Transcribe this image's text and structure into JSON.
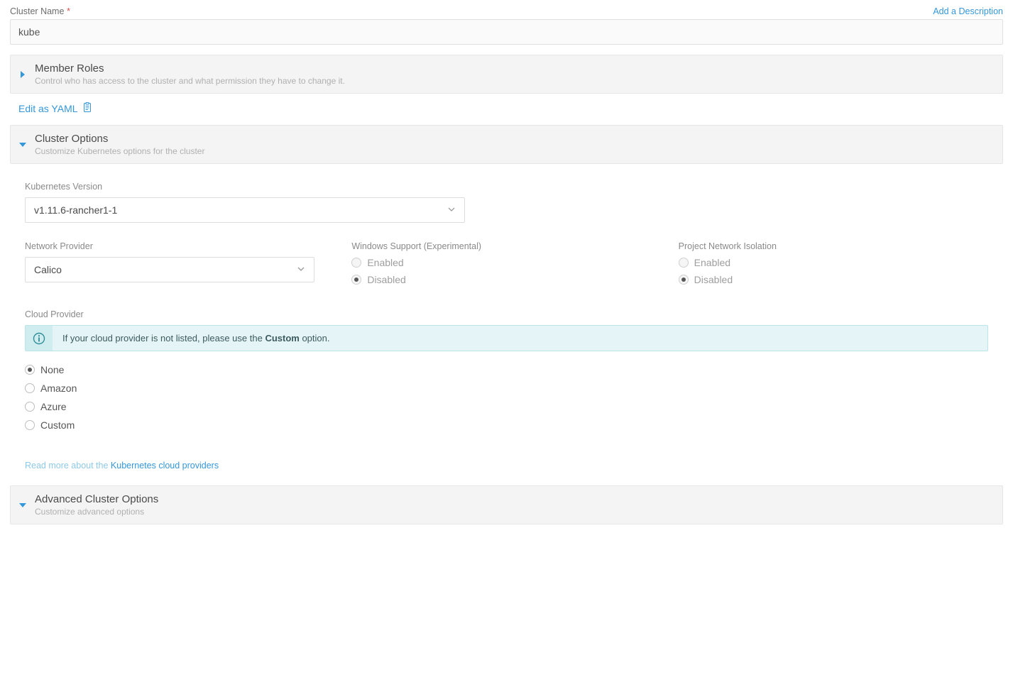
{
  "form": {
    "cluster_name_label": "Cluster Name",
    "add_description": "Add a Description",
    "cluster_name_value": "kube"
  },
  "sections": {
    "member_roles": {
      "title": "Member Roles",
      "desc": "Control who has access to the cluster and what permission they have to change it."
    },
    "edit_yaml": "Edit as YAML",
    "cluster_options": {
      "title": "Cluster Options",
      "desc": "Customize Kubernetes options for the cluster"
    },
    "advanced": {
      "title": "Advanced Cluster Options",
      "desc": "Customize advanced options"
    }
  },
  "options": {
    "k8s_version_label": "Kubernetes Version",
    "k8s_version_value": "v1.11.6-rancher1-1",
    "network_provider_label": "Network Provider",
    "network_provider_value": "Calico",
    "windows_support_label": "Windows Support (Experimental)",
    "windows_enabled": "Enabled",
    "windows_disabled": "Disabled",
    "pni_label": "Project Network Isolation",
    "pni_enabled": "Enabled",
    "pni_disabled": "Disabled",
    "cloud_provider_label": "Cloud Provider",
    "cloud_info_prefix": "If your cloud provider is not listed, please use the ",
    "cloud_info_strong": "Custom",
    "cloud_info_suffix": " option.",
    "cloud_choices": [
      "None",
      "Amazon",
      "Azure",
      "Custom"
    ],
    "read_more_prefix": "Read more about the ",
    "read_more_link": "Kubernetes cloud providers"
  }
}
